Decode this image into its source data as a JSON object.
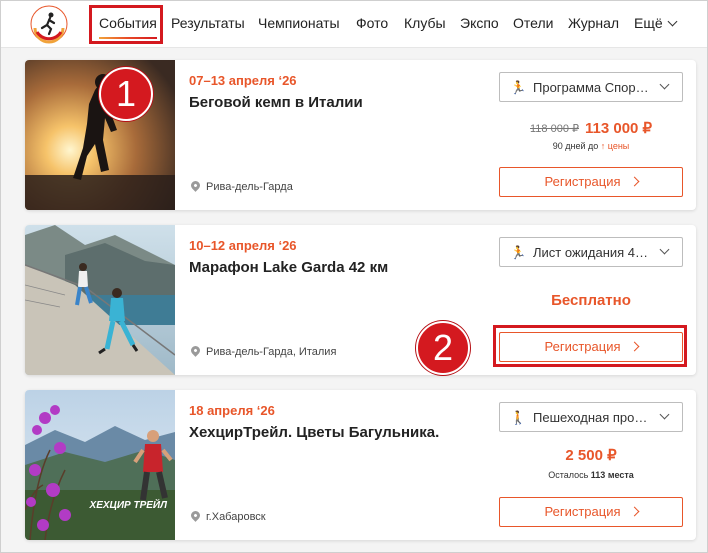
{
  "nav": {
    "items": [
      {
        "label": "События"
      },
      {
        "label": "Результаты"
      },
      {
        "label": "Чемпионаты"
      },
      {
        "label": "Фото"
      },
      {
        "label": "Клубы"
      },
      {
        "label": "Экспо"
      },
      {
        "label": "Отели"
      },
      {
        "label": "Журнал"
      },
      {
        "label": "Ещё"
      }
    ]
  },
  "logo_text": "RUSSIA RUNNING",
  "events": [
    {
      "date": "07–13 апреля ‘26",
      "title": "Беговой кемп в Италии",
      "location": "Рива-дель-Гарда",
      "distance_select": "Программа Спор…",
      "price_old": "118 000 ₽",
      "price_new": "113 000 ₽",
      "note_prefix": "90 дней до ",
      "note_suffix": "↑ цены",
      "register": "Регистрация"
    },
    {
      "date": "10–12 апреля ‘26",
      "title": "Марафон Lake Garda 42 км",
      "location": "Рива-дель-Гарда, Италия",
      "distance_select": "Лист ожидания 4…",
      "price": "Бесплатно",
      "register": "Регистрация"
    },
    {
      "date": "18 апреля ‘26",
      "title": "ХехцирТрейл. Цветы Багульника.",
      "location": "г.Хабаровск",
      "distance_select": "Пешеходная про…",
      "price": "2 500 ₽",
      "note_prefix": "Осталось ",
      "note_bold": "113 места",
      "register": "Регистрация",
      "image_logo": "ХЕХЦИР ТРЕЙЛ"
    }
  ],
  "badges": {
    "one": "1",
    "two": "2"
  },
  "colors": {
    "accent": "#e8562a",
    "highlight": "#d4191f"
  }
}
